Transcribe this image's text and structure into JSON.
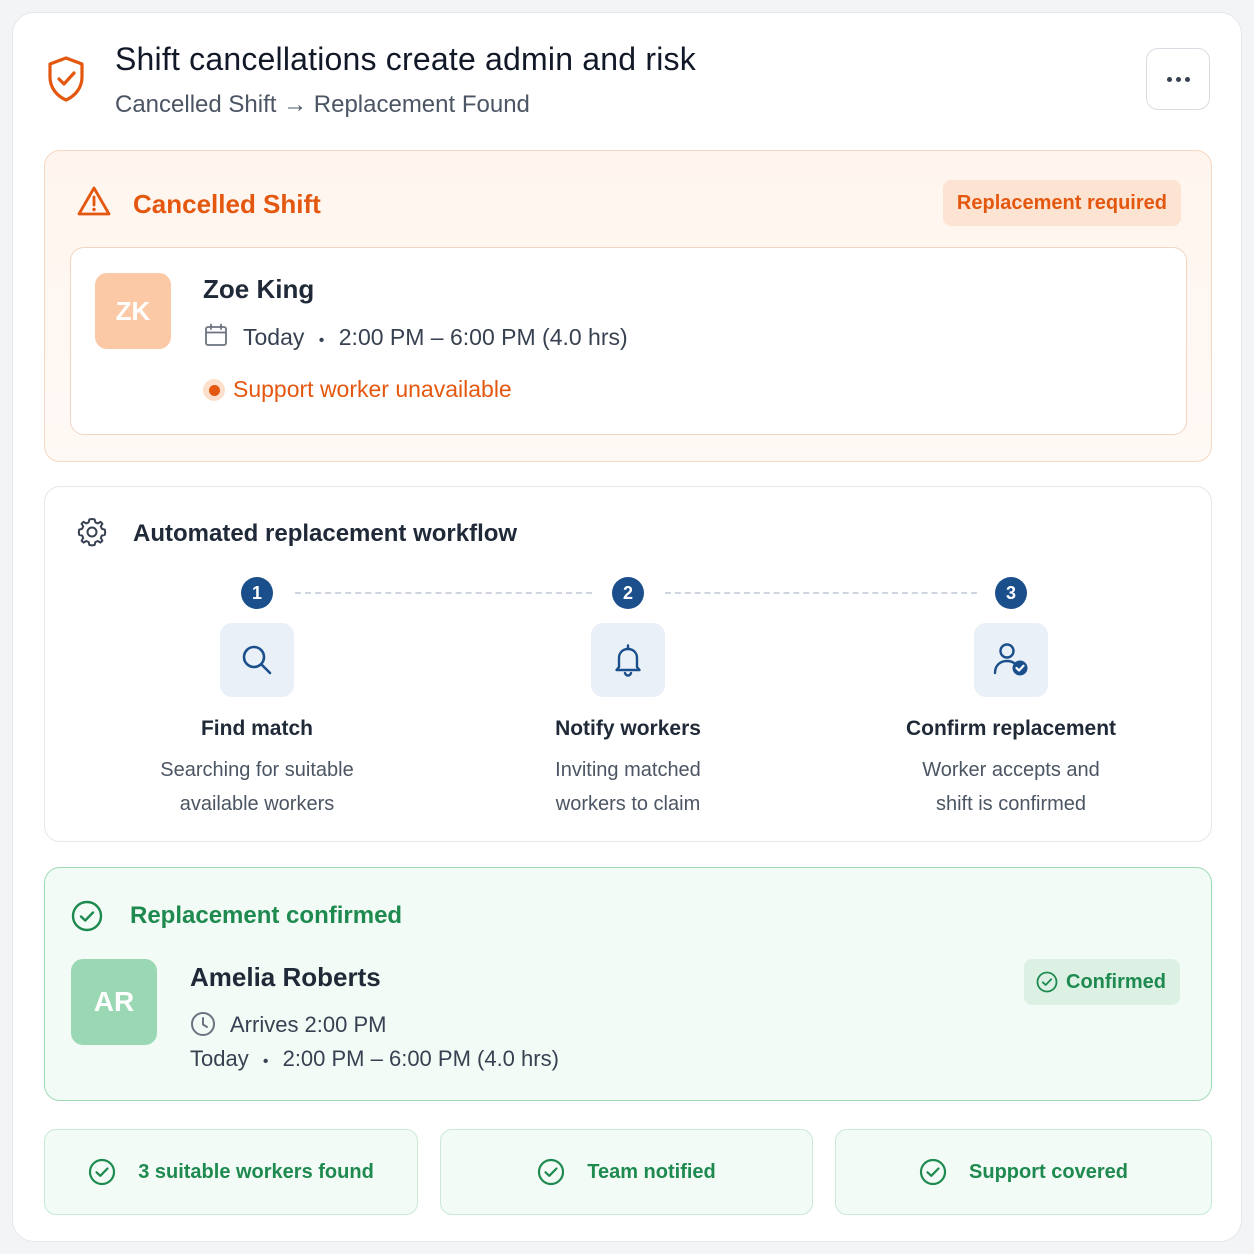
{
  "header": {
    "title": "Shift cancellations create admin and risk",
    "subtitle": "Cancelled Shift → Replacement Found",
    "icon": "shield-check-icon",
    "more_icon": "more-horizontal-icon"
  },
  "cancelled": {
    "title": "Cancelled Shift",
    "badge": "Replacement required",
    "worker": {
      "initials": "ZK",
      "name": "Zoe King",
      "day": "Today",
      "separator": "•",
      "time": "2:00 PM – 6:00 PM (4.0 hrs)",
      "status": "Support worker unavailable"
    }
  },
  "workflow": {
    "title": "Automated replacement workflow",
    "steps": [
      {
        "num": "1",
        "icon": "search-icon",
        "title": "Find match",
        "desc_line1": "Searching for suitable",
        "desc_line2": "available workers"
      },
      {
        "num": "2",
        "icon": "bell-icon",
        "title": "Notify workers",
        "desc_line1": "Inviting matched",
        "desc_line2": "workers to claim"
      },
      {
        "num": "3",
        "icon": "user-check-icon",
        "title": "Confirm replacement",
        "desc_line1": "Worker accepts and",
        "desc_line2": "shift is confirmed"
      }
    ]
  },
  "confirmed": {
    "title": "Replacement confirmed",
    "badge": "Confirmed",
    "worker": {
      "initials": "AR",
      "name": "Amelia Roberts",
      "arrives": "Arrives 2:00 PM",
      "day": "Today",
      "separator": "•",
      "time": "2:00 PM – 6:00 PM (4.0 hrs)"
    }
  },
  "summary": [
    {
      "label": "3 suitable workers found"
    },
    {
      "label": "Team notified"
    },
    {
      "label": "Support covered"
    }
  ],
  "colors": {
    "accent_orange": "#e4570f",
    "accent_green": "#1e8a4f",
    "accent_blue": "#1a4f8b"
  }
}
